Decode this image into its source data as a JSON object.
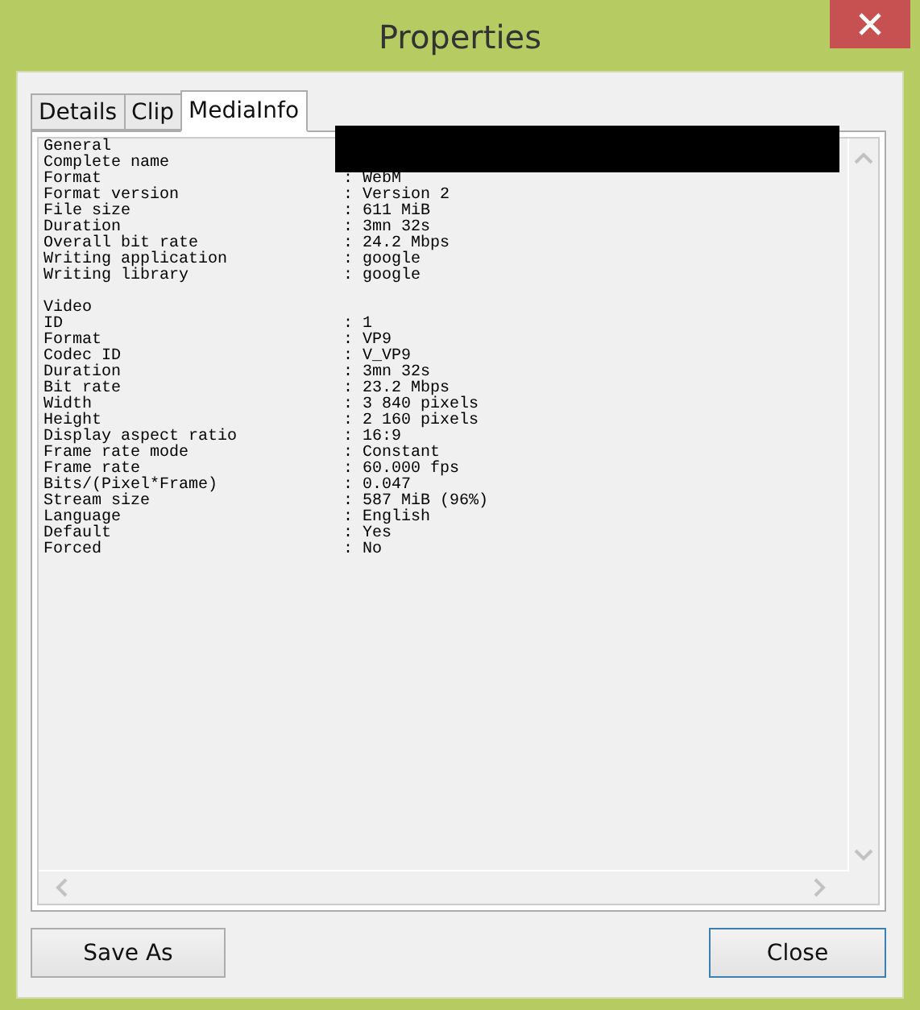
{
  "window": {
    "title": "Properties"
  },
  "tabs": [
    {
      "label": "Details",
      "selected": false
    },
    {
      "label": "Clip",
      "selected": false
    },
    {
      "label": "MediaInfo",
      "selected": true
    }
  ],
  "sections": [
    {
      "heading": "General",
      "fields": [
        {
          "label": "Complete name"
        },
        {
          "label": "Format",
          "value": ": WebM"
        },
        {
          "label": "Format version",
          "value": ": Version 2"
        },
        {
          "label": "File size",
          "value": ": 611 MiB"
        },
        {
          "label": "Duration",
          "value": ": 3mn 32s"
        },
        {
          "label": "Overall bit rate",
          "value": ": 24.2 Mbps"
        },
        {
          "label": "Writing application",
          "value": ": google"
        },
        {
          "label": "Writing library",
          "value": ": google"
        }
      ]
    },
    {
      "heading": "Video",
      "fields": [
        {
          "label": "ID",
          "value": ": 1"
        },
        {
          "label": "Format",
          "value": ": VP9"
        },
        {
          "label": "Codec ID",
          "value": ": V_VP9"
        },
        {
          "label": "Duration",
          "value": ": 3mn 32s"
        },
        {
          "label": "Bit rate",
          "value": ": 23.2 Mbps"
        },
        {
          "label": "Width",
          "value": ": 3 840 pixels"
        },
        {
          "label": "Height",
          "value": ": 2 160 pixels"
        },
        {
          "label": "Display aspect ratio",
          "value": ": 16:9"
        },
        {
          "label": "Frame rate mode",
          "value": ": Constant"
        },
        {
          "label": "Frame rate",
          "value": ": 60.000 fps"
        },
        {
          "label": "Bits/(Pixel*Frame)",
          "value": ": 0.047"
        },
        {
          "label": "Stream size",
          "value": ": 587 MiB (96%)"
        },
        {
          "label": "Language",
          "value": ": English"
        },
        {
          "label": "Default",
          "value": ": Yes"
        },
        {
          "label": "Forced",
          "value": ": No"
        }
      ]
    }
  ],
  "buttons": [
    {
      "label": "Save As",
      "default": false
    },
    {
      "label": "Close",
      "default": true
    }
  ]
}
